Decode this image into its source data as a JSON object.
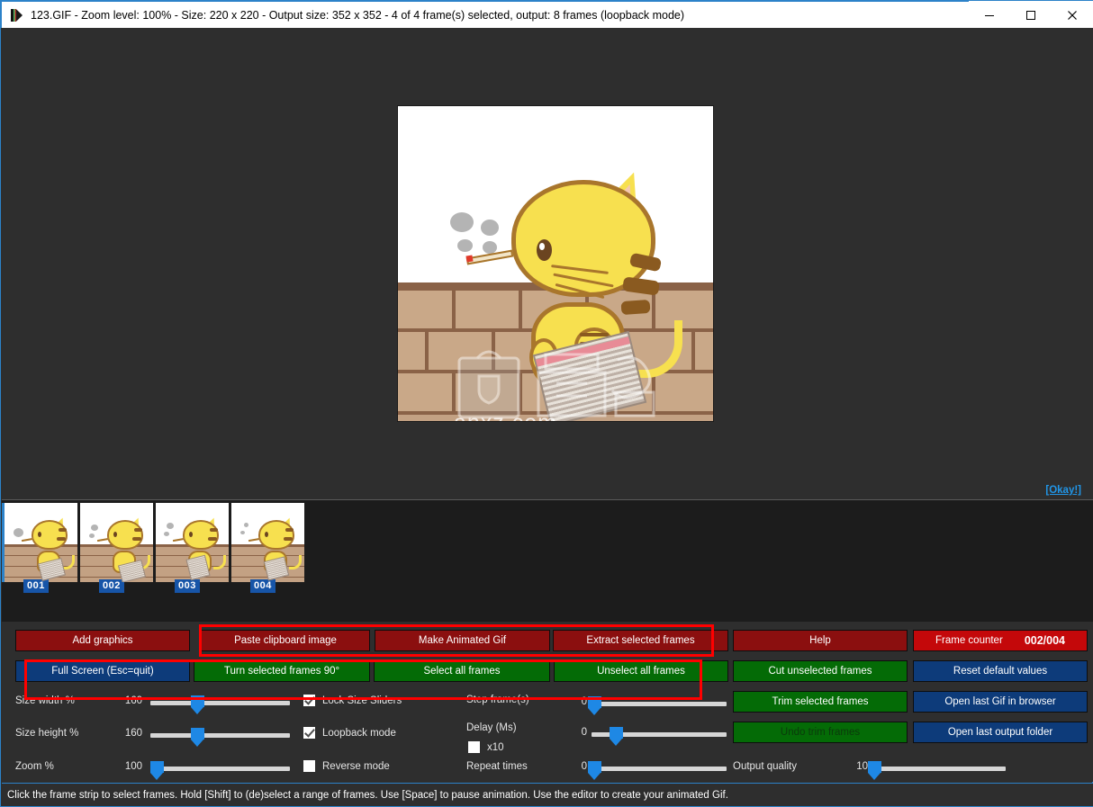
{
  "window": {
    "title": "123.GIF - Zoom level: 100% - Size: 220 x 220 - Output size: 352 x 352 - 4 of 4 frame(s) selected, output: 8 frames (loopback mode)",
    "icon": "gif-player-icon",
    "minimize": "–",
    "maximize": "□",
    "close": "✕"
  },
  "preview": {
    "okay_label": "[Okay!]",
    "watermark_text": "anxz.com",
    "canvas_width": "352",
    "canvas_height": "352"
  },
  "frames": [
    {
      "label": "001",
      "selected": true
    },
    {
      "label": "002",
      "selected": false
    },
    {
      "label": "003",
      "selected": false
    },
    {
      "label": "004",
      "selected": false
    }
  ],
  "buttons": {
    "add_graphics": "Add graphics",
    "paste_clipboard": "Paste clipboard image",
    "make_animated_gif": "Make Animated Gif",
    "extract_selected": "Extract selected frames",
    "help": "Help",
    "full_screen": "Full Screen (Esc=quit)",
    "turn_90": "Turn selected frames 90°",
    "select_all": "Select all frames",
    "unselect_all": "Unselect all frames",
    "cut_unselected": "Cut unselected frames",
    "trim_selected": "Trim selected frames",
    "undo_trim": "Undo trim frames",
    "reset_defaults": "Reset default values",
    "open_gif_browser": "Open last Gif in browser",
    "open_output_folder": "Open last output folder"
  },
  "frame_counter": {
    "label": "Frame counter",
    "value": "002/004"
  },
  "sliders": {
    "size_width": {
      "label": "Size width %",
      "value": "160",
      "percent": 32
    },
    "size_height": {
      "label": "Size height %",
      "value": "160",
      "percent": 32
    },
    "zoom": {
      "label": "Zoom %",
      "value": "100",
      "percent": 2
    },
    "step_frames": {
      "label": "Step frame(s)",
      "value": "0",
      "percent": 2
    },
    "delay_ms": {
      "label": "Delay (Ms)",
      "value": "0",
      "percent": 16
    },
    "repeat_times": {
      "label": "Repeat times",
      "value": "0",
      "percent": 2
    },
    "output_quality": {
      "label": "Output quality",
      "value": "10",
      "percent": 2
    }
  },
  "checkboxes": {
    "lock_size": {
      "label": "Lock Size Sliders",
      "checked": true
    },
    "loopback": {
      "label": "Loopback mode",
      "checked": true
    },
    "reverse": {
      "label": "Reverse mode",
      "checked": false
    },
    "x10": {
      "label": "x10",
      "checked": false
    }
  },
  "status": {
    "text": "Click the frame strip to select frames. Hold [Shift] to (de)select a range of frames. Use [Space] to pause animation. Use the editor to create your animated Gif."
  },
  "colors": {
    "accent_blue": "#2c82c9",
    "dark_red_button": "#8b0f0f",
    "bright_red_button": "#c4080a",
    "green_button": "#046b06",
    "blue_button": "#0d3b7a",
    "highlight_red": "#ff0000",
    "panel_bg": "#2e2e2e",
    "strip_bg": "#1c1c1c",
    "slider_blue": "#1e88e5"
  }
}
